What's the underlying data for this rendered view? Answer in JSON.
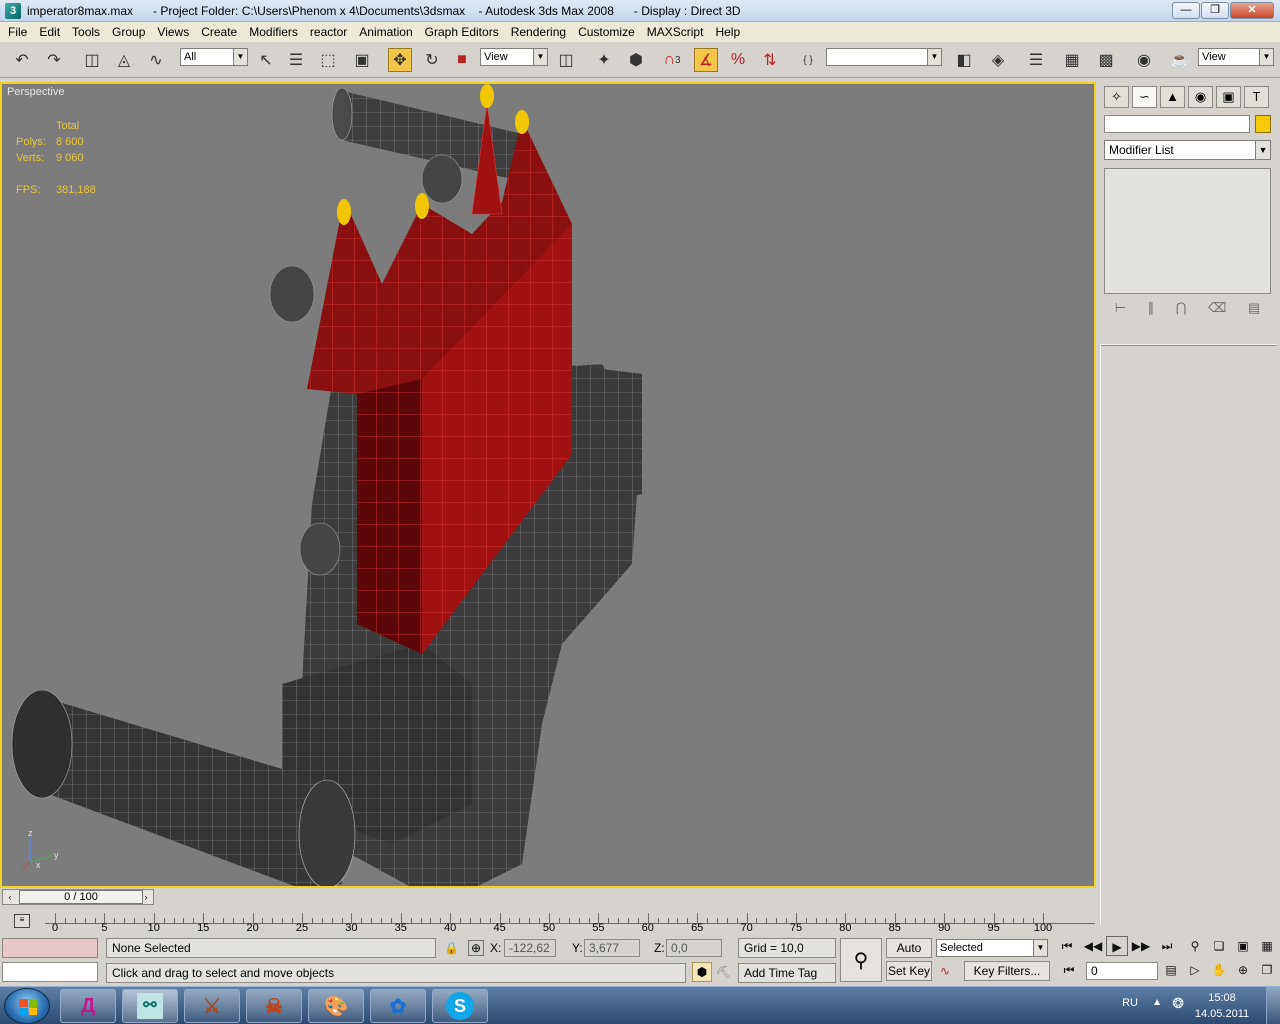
{
  "window": {
    "title": "imperator8max.max      - Project Folder: C:\\Users\\Phenom x 4\\Documents\\3dsmax    - Autodesk 3ds Max 2008      - Display : Direct 3D",
    "buttons": [
      "minimize-icon",
      "restore-icon",
      "close-icon"
    ]
  },
  "menu": [
    "File",
    "Edit",
    "Tools",
    "Group",
    "Views",
    "Create",
    "Modifiers",
    "reactor",
    "Animation",
    "Graph Editors",
    "Rendering",
    "Customize",
    "MAXScript",
    "Help"
  ],
  "toolbar": {
    "selection_filter": "All",
    "reference_coord": "View",
    "snap_count": "3",
    "named_selection": "",
    "render_view": "View"
  },
  "viewport": {
    "label": "Perspective",
    "stats": {
      "header": "Total",
      "polys_label": "Polys:",
      "polys_value": "8 600",
      "verts_label": "Verts:",
      "verts_value": "9 060",
      "fps_label": "FPS:",
      "fps_value": "381,188"
    },
    "axis_labels": {
      "z": "z",
      "x": "x",
      "y": "y"
    },
    "colors": {
      "background": "#7c7c7c",
      "active_border": "#f2d21e",
      "selected_mesh": "#b01414",
      "mesh": "#3c3c3c",
      "flame": "#f2c600"
    }
  },
  "command_panel": {
    "modifier_list": "Modifier List",
    "object_color": "#f7c90a"
  },
  "timeline": {
    "slider_label": "0 / 100",
    "ticks": [
      "0",
      "5",
      "10",
      "15",
      "20",
      "25",
      "30",
      "35",
      "40",
      "45",
      "50",
      "55",
      "60",
      "65",
      "70",
      "75",
      "80",
      "85",
      "90",
      "95",
      "100"
    ]
  },
  "status": {
    "selection": "None Selected",
    "prompt": "Click and drag to select and move objects",
    "x_label": "X:",
    "x_value": "-122,62",
    "y_label": "Y:",
    "y_value": "3,677",
    "z_label": "Z:",
    "z_value": "0,0",
    "grid": "Grid = 10,0",
    "add_time_tag": "Add Time Tag",
    "auto_key": "Auto Key",
    "set_key": "Set Key",
    "key_mode": "Selected",
    "key_filters": "Key Filters...",
    "current_frame": "0"
  },
  "taskbar": {
    "lang": "RU",
    "time": "15:08",
    "date": "14.05.2011",
    "apps": [
      "agent-icon",
      "3dsmax-icon",
      "game-icon-1",
      "game-icon-2",
      "paint-icon",
      "messenger-icon",
      "skype-icon"
    ]
  }
}
